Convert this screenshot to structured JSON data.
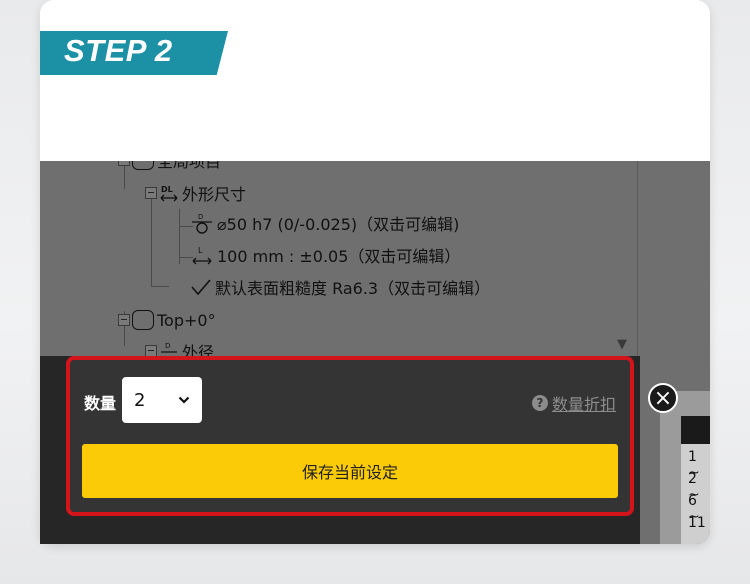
{
  "step": {
    "label": "STEP 2"
  },
  "tree": {
    "rows": [
      {
        "label": "全局项目"
      },
      {
        "label": "外形尺寸",
        "icon": "DL"
      },
      {
        "label": "⌀50 h7 (0/-0.025)（双击可编辑)"
      },
      {
        "label": "100 mm : ±0.05（双击可编辑）"
      },
      {
        "label": "默认表面粗糙度 Ra6.3（双击可编辑）"
      },
      {
        "label": "Top+0°"
      },
      {
        "label": "外径"
      }
    ]
  },
  "right_table": {
    "rows": [
      "1 ~",
      "2 ~",
      "6 ~",
      "11"
    ]
  },
  "order": {
    "quantity_label": "数量",
    "quantity_value": "2",
    "discount_label": "数量折扣",
    "save_label": "保存当前设定"
  },
  "colors": {
    "accent": "#1c91a6",
    "highlight_border": "#d4141b",
    "save_button": "#fccb08"
  }
}
